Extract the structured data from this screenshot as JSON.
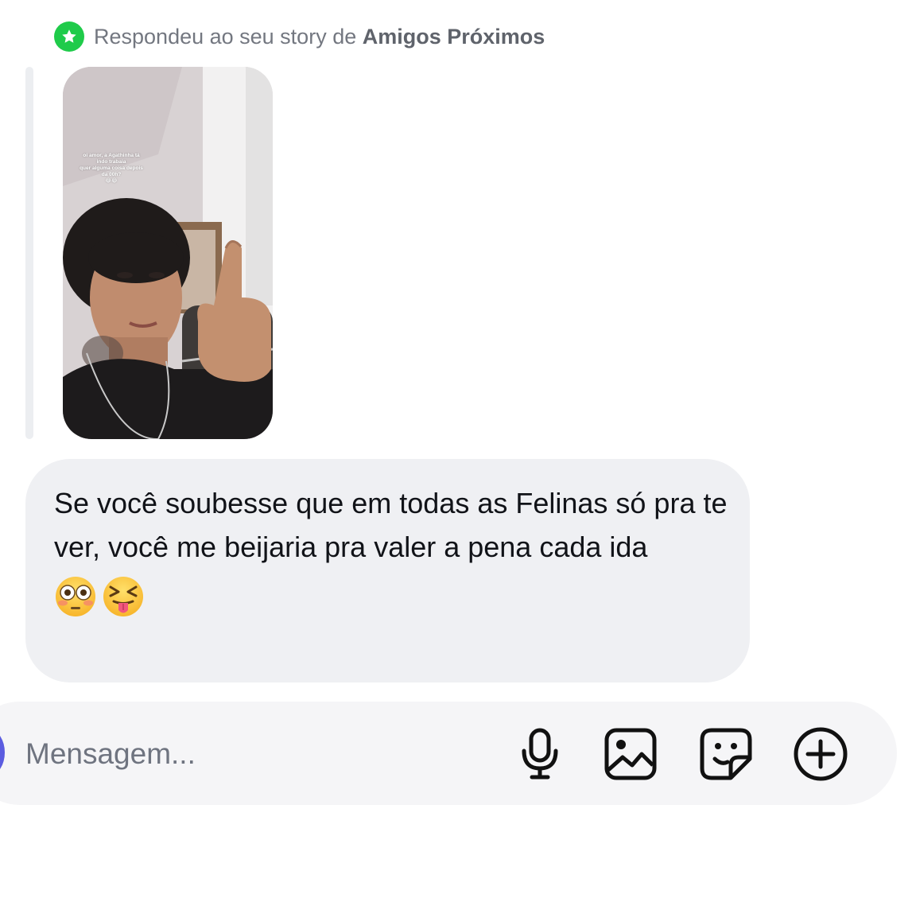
{
  "reply_header": {
    "prefix": "Respondeu ao seu story de",
    "audience": "Amigos Próximos",
    "badge_icon": "star-icon",
    "badge_color": "#1fcb4a"
  },
  "story": {
    "caption_lines": [
      "oi amor, a Agathinha tá",
      "indo trabaia",
      "quer alguma coisa depois",
      "da 00h?",
      "😂😂"
    ]
  },
  "message": {
    "text": "Se você soubesse que em todas as Felinas só pra te ver, você me beijaria pra valer a pena cada ida",
    "emojis": [
      "flushed-face",
      "squinting-face-with-tongue"
    ],
    "bubble_color": "#eff0f3"
  },
  "composer": {
    "placeholder": "Mensagem...",
    "tools": [
      "microphone-icon",
      "image-icon",
      "sticker-icon",
      "plus-circle-icon"
    ]
  }
}
